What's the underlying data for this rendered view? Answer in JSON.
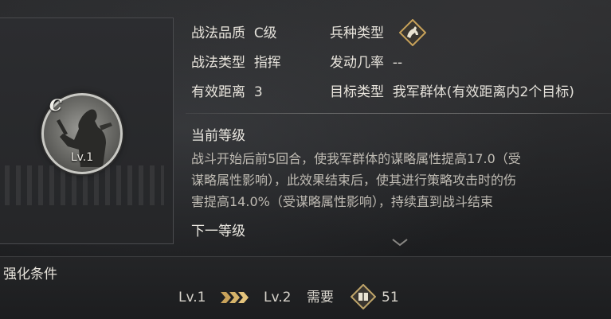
{
  "tactic": {
    "grade_letter": "C",
    "level_badge": "Lv.1",
    "quality_label": "战法品质",
    "quality_value": "C级",
    "type_label": "战法类型",
    "type_value": "指挥",
    "range_label": "有效距离",
    "range_value": "3",
    "troop_label": "兵种类型",
    "troop_icon": "horse-cavalry-icon",
    "rate_label": "发动几率",
    "rate_value": "--",
    "target_label": "目标类型",
    "target_value": "我军群体(有效距离内2个目标)"
  },
  "current_level": {
    "title": "当前等级",
    "lines": [
      "战斗开始后前5回合，使我军群体的谋略属性提高17.0（受",
      "谋略属性影响），此效果结束后，使其进行策略攻击时的伤",
      "害提高14.0%（受谋略属性影响），持续直到战斗结束"
    ]
  },
  "next_level": {
    "title": "下一等级"
  },
  "upgrade": {
    "title": "强化条件",
    "from_level": "Lv.1",
    "to_level": "Lv.2",
    "need_label": "需要",
    "cost_icon": "tactic-book-icon",
    "cost_value": "51"
  },
  "colors": {
    "accent_gold": "#c8a25a",
    "text_main": "#e4e1da",
    "text_desc": "#bfbbb3"
  }
}
